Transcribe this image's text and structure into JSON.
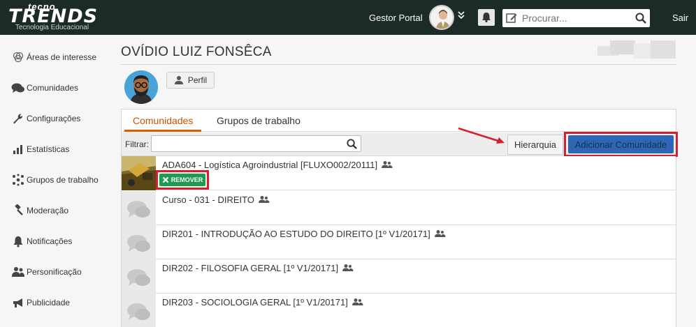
{
  "header": {
    "logo_top": "tecno",
    "logo_main": "TRENDS",
    "logo_sub": "Tecnologia Educacional",
    "user_name": "Gestor Portal",
    "search_placeholder": "Procurar...",
    "logout_label": "Sair"
  },
  "sidebar": {
    "items": [
      {
        "label": "Áreas de interesse",
        "icon": "interest-areas-icon"
      },
      {
        "label": "Comunidades",
        "icon": "communities-icon"
      },
      {
        "label": "Configurações",
        "icon": "wrench-icon"
      },
      {
        "label": "Estatísticas",
        "icon": "bar-chart-icon"
      },
      {
        "label": "Grupos de trabalho",
        "icon": "workgroups-icon"
      },
      {
        "label": "Moderação",
        "icon": "gavel-icon"
      },
      {
        "label": "Notificações",
        "icon": "bell-icon"
      },
      {
        "label": "Personificação",
        "icon": "users-icon"
      },
      {
        "label": "Publicidade",
        "icon": "megaphone-icon"
      }
    ]
  },
  "main": {
    "page_title": "OVÍDIO LUIZ FONSÊCA",
    "profile_button": "Perfil",
    "tabs": [
      {
        "label": "Comunidades",
        "active": true
      },
      {
        "label": "Grupos de trabalho",
        "active": false
      }
    ],
    "filter_label": "Filtrar:",
    "filter_value": "",
    "hierarchy_button": "Hierarquia",
    "add_button": "Adicionar Comunidade",
    "remove_button": "REMOVER",
    "communities": [
      {
        "name": "ADA604 - Logística Agroindustrial [FLUXO002/20111]",
        "thumb": "photo"
      },
      {
        "name": "Curso - 031 - DIREITO",
        "thumb": "chat"
      },
      {
        "name": "DIR201 - INTRODUÇÃO AO ESTUDO DO DIREITO [1º V1/20171]",
        "thumb": "chat"
      },
      {
        "name": "DIR202 - FILOSOFIA GERAL [1º V1/20171]",
        "thumb": "chat"
      },
      {
        "name": "DIR203 - SOCIOLOGIA GERAL [1º V1/20171]",
        "thumb": "chat"
      }
    ]
  },
  "colors": {
    "topbar": "#1d2b26",
    "tab_active": "#d45e00",
    "primary_button": "#2d67b4",
    "remove_button": "#1d9b50",
    "highlight": "#d2202e"
  }
}
